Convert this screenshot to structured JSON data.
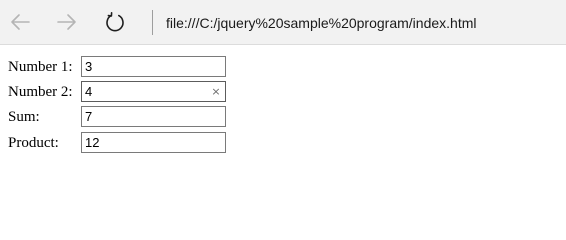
{
  "browser": {
    "address": "file:///C:/jquery%20sample%20program/index.html",
    "back_icon": "arrow-left-icon",
    "forward_icon": "arrow-right-icon",
    "refresh_icon": "refresh-icon",
    "clear_glyph": "×"
  },
  "form": {
    "fields": [
      {
        "label": "Number 1:",
        "value": "3"
      },
      {
        "label": "Number 2:",
        "value": "4"
      },
      {
        "label": "Sum:",
        "value": "7"
      },
      {
        "label": "Product:",
        "value": "12"
      }
    ]
  }
}
